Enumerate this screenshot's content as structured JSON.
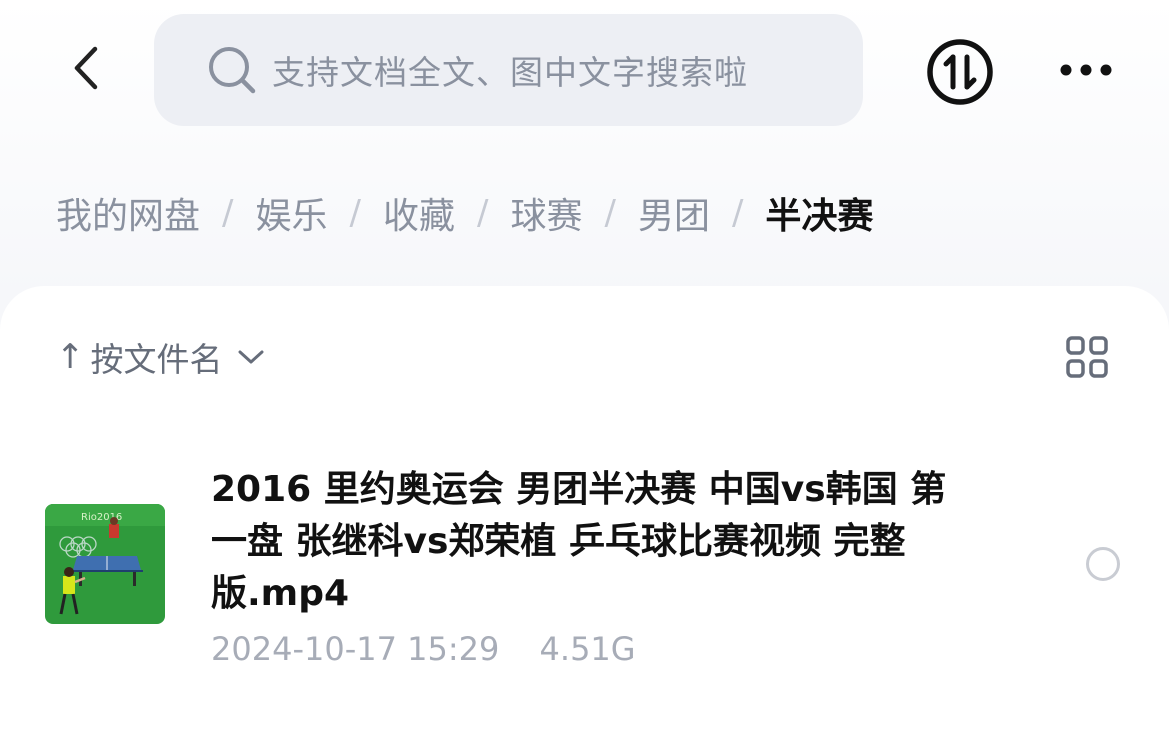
{
  "header": {
    "back_icon": "chevron-left-icon",
    "search": {
      "icon": "search-icon",
      "placeholder": "支持文档全文、图中文字搜索啦"
    },
    "transfer_icon": "transfer-icon",
    "more_icon": "more-dots-icon"
  },
  "breadcrumb": {
    "items": [
      "我的网盘",
      "娱乐",
      "收藏",
      "球赛",
      "男团"
    ],
    "current": "半决赛",
    "separator": "/"
  },
  "toolbar": {
    "sort_arrow": "↑",
    "sort_label": "按文件名",
    "sort_chevron_icon": "chevron-down-icon",
    "view_toggle_icon": "grid-icon"
  },
  "files": [
    {
      "name": "2016 里约奥运会 男团半决赛 中国vs韩国  第一盘 张继科vs郑荣植 乒乓球比赛视频 完整版.mp4",
      "date": "2024-10-17 15:29",
      "size": "4.51G",
      "thumbnail_text": "Rio2016",
      "selected": false
    }
  ],
  "colors": {
    "accent_text": "#111111",
    "muted_text": "#8a919f",
    "meta_text": "#a7acb7",
    "search_bg": "#edeff4",
    "thumbnail_green": "#2f9a3c",
    "table_blue": "#3f6fb0"
  }
}
